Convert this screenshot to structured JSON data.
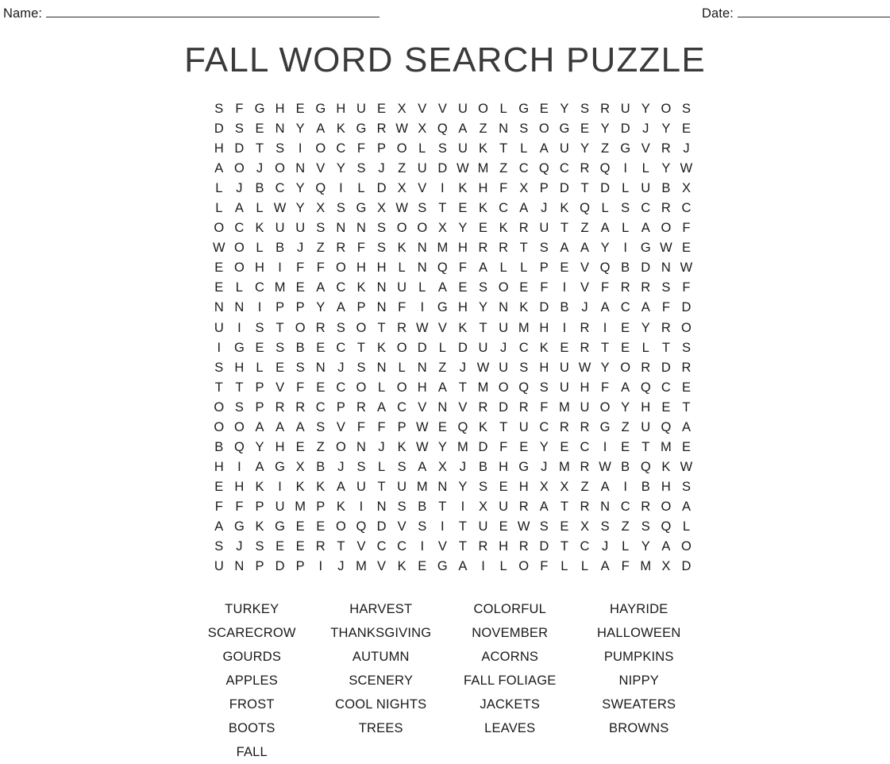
{
  "header": {
    "name_label": "Name:",
    "date_label": "Date:"
  },
  "title": "FALL WORD SEARCH PUZZLE",
  "grid": {
    "rows": 24,
    "cols": 24,
    "letters": [
      "S F G H E G H U E X V V U O L G E Y S R U Y O S",
      "D S E N Y A K G R W X Q A Z N S O G E Y D J Y E",
      "H D T S I O C F P O L S U K T L A U Y Z G V R J",
      "A O J O N V Y S J Z U D W M Z C Q C R Q I L Y W",
      "L J B C Y Q I L D X V I K H F X P D T D L U B X",
      "L A L W Y X S G X W S T E K C A J K Q L S C R C",
      "O C K U U S N N S O O X Y E K R U T Z A L A O F",
      "W O L B J Z R F S K N M H R R T S A A Y I G W E",
      "E O H I F F O H H L N Q F A L L P E V Q B D N W",
      "E L C M E A C K N U L A E S O E F I V F R R S F",
      "N N I P P Y A P N F I G H Y N K D B J A C A F D",
      "U I S T O R S O T R W V K T U M H I R I E Y R O",
      "I G E S B E C T K O D L D U J C K E R T E L T S",
      "S H L E S N J S N L N Z J W U S H U W Y O R D R",
      "T T P V F E C O L O H A T M O Q S U H F A Q C E",
      "O S P R R C P R A C V N V R D R F M U O Y H E T",
      "O O A A A S V F F P W E Q K T U C R R G Z U Q A",
      "B Q Y H E Z O N J K W Y M D F E Y E C I E T M E",
      "H I A G X B J S L S A X J B H G J M R W B Q K W",
      "E H K I K K A U T U M N Y S E H X X Z A I B H S",
      "F F P U M P K I N S B T I X U R A T R N C R O A",
      "A G K G E E O Q D V S I T U E W S E X S Z S Q L",
      "S J S E E R T V C C I V T R H R D T C J L Y A O",
      "U N P D P I J M V K E G A I L O F L L A F M X D"
    ]
  },
  "word_list": {
    "columns": 4,
    "words": [
      "TURKEY",
      "HARVEST",
      "COLORFUL",
      "HAYRIDE",
      "SCARECROW",
      "THANKSGIVING",
      "NOVEMBER",
      "HALLOWEEN",
      "GOURDS",
      "AUTUMN",
      "ACORNS",
      "PUMPKINS",
      "APPLES",
      "SCENERY",
      "FALL FOLIAGE",
      "NIPPY",
      "FROST",
      "COOL NIGHTS",
      "JACKETS",
      "SWEATERS",
      "BOOTS",
      "TREES",
      "LEAVES",
      "BROWNS",
      "FALL",
      "",
      "",
      ""
    ]
  },
  "colors": {
    "text": "#1a1a1a",
    "title": "#3a3a3a",
    "rule": "#2b2b2b",
    "background": "#ffffff"
  }
}
